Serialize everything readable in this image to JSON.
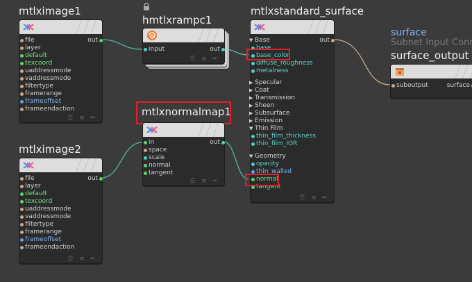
{
  "colors": {
    "background": "#3b3b3b",
    "node_body": "#2b2b2b",
    "node_header": "#dddddd",
    "wire": "#52b8a8",
    "highlight": "#e0202a",
    "output_title": "#7fb2ee"
  },
  "nodes": {
    "image1": {
      "title": "mtlximage1",
      "icon": "materialx-icon",
      "out_label": "out",
      "inputs": [
        "file",
        "layer",
        "default",
        "texcoord",
        "uaddressmode",
        "vaddressmode",
        "filtertype",
        "framerange",
        "frameoffset",
        "frameendaction"
      ]
    },
    "image2": {
      "title": "mtlximage2",
      "icon": "materialx-icon",
      "out_label": "out",
      "inputs": [
        "file",
        "layer",
        "default",
        "texcoord",
        "uaddressmode",
        "vaddressmode",
        "filtertype",
        "framerange",
        "frameoffset",
        "frameendaction"
      ]
    },
    "ramp": {
      "title": "hmtlxrampc1",
      "icon": "houdini-swirl-icon",
      "lock_icon": "lock-icon",
      "in_label": "input",
      "out_label": "out"
    },
    "normalmap": {
      "title": "mtlxnormalmap1",
      "icon": "materialx-icon",
      "out_label": "out",
      "inputs": [
        "in",
        "space",
        "scale",
        "normal",
        "tangent"
      ]
    },
    "standard": {
      "title": "mtlxstandard_surface",
      "icon": "materialx-icon",
      "out_label": "out",
      "base_section": "Base",
      "base_inputs": [
        "base",
        "base_color",
        "diffuse_roughness",
        "metalness"
      ],
      "sections": [
        "Specular",
        "Coat",
        "Transmission",
        "Sheen",
        "Subsurface",
        "Emission"
      ],
      "thinfilm_section": "Thin Film",
      "thinfilm_inputs": [
        "thin_film_thickness",
        "thin_film_IOR"
      ],
      "geometry_section": "Geometry",
      "geometry_inputs": [
        "opacity",
        "thin_walled",
        "normal",
        "tangent"
      ]
    },
    "output": {
      "title_top": "surface",
      "subtitle": "Subnet Input Conn",
      "title": "surface_output",
      "icon": "subnet-box-icon",
      "in_label": "suboutput",
      "out_label": "surface"
    }
  }
}
